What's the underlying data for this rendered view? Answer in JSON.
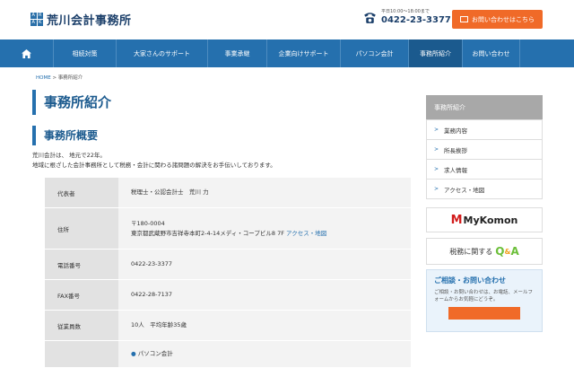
{
  "header": {
    "logo_text": "荒川会計事務所",
    "logo_mark": [
      "A",
      "R",
      "A",
      "K"
    ],
    "hours": "平日10:00～18:00まで",
    "phone": "0422-23-3377",
    "contact_label": "お問い合わせはこちら"
  },
  "nav": {
    "items": [
      {
        "label": "相続対策"
      },
      {
        "label": "大家さんのサポート"
      },
      {
        "label": "事業承継"
      },
      {
        "label": "企業向けサポート"
      },
      {
        "label": "パソコン会計"
      },
      {
        "label": "事務所紹介"
      },
      {
        "label": "お問い合わせ"
      }
    ],
    "active": "事務所紹介"
  },
  "breadcrumb": {
    "home": "HOME",
    "separator": ">",
    "current": "事務所紹介"
  },
  "main": {
    "title": "事務所紹介",
    "subtitle": "事務所概要",
    "intro_line1": "荒川会計は、 地元で22年。",
    "intro_line2": "地域に根ざした会計事務所として税務・会計に関わる諸問題の解決をお手伝いしております。",
    "table": {
      "rows": [
        {
          "label": "代表者",
          "value": "税理士・公認会計士　荒川 力"
        },
        {
          "label": "住所",
          "postal": "〒180-0004",
          "address": "東京都武蔵野市吉祥寺本町2-4-14メディ・コープビル8 7F",
          "link": "アクセス・地図"
        },
        {
          "label": "電話番号",
          "value": "0422-23-3377"
        },
        {
          "label": "FAX番号",
          "value": "0422-28-7137"
        },
        {
          "label": "従業員数",
          "value": "10人　平均年齢35歳"
        },
        {
          "label": "",
          "value": "パソコン会計"
        }
      ]
    }
  },
  "sidebar": {
    "heading": "事務所紹介",
    "items": [
      {
        "label": "業務内容"
      },
      {
        "label": "所長挨拶"
      },
      {
        "label": "求人情報"
      },
      {
        "label": "アクセス・地図"
      }
    ],
    "mykomon_m": "M",
    "mykomon_text": "MyKomon",
    "qa_prefix": "税務に関する",
    "qa_q": "Q",
    "qa_amp": "&",
    "qa_a": "A",
    "consult_title": "ご相談・お問い合わせ",
    "consult_text": "ご相談・お問い合わせは、お電話、メールフォームからお気軽にどうぞ。"
  },
  "colors": {
    "brand_blue": "#2570ae",
    "accent_orange": "#f06a28"
  }
}
